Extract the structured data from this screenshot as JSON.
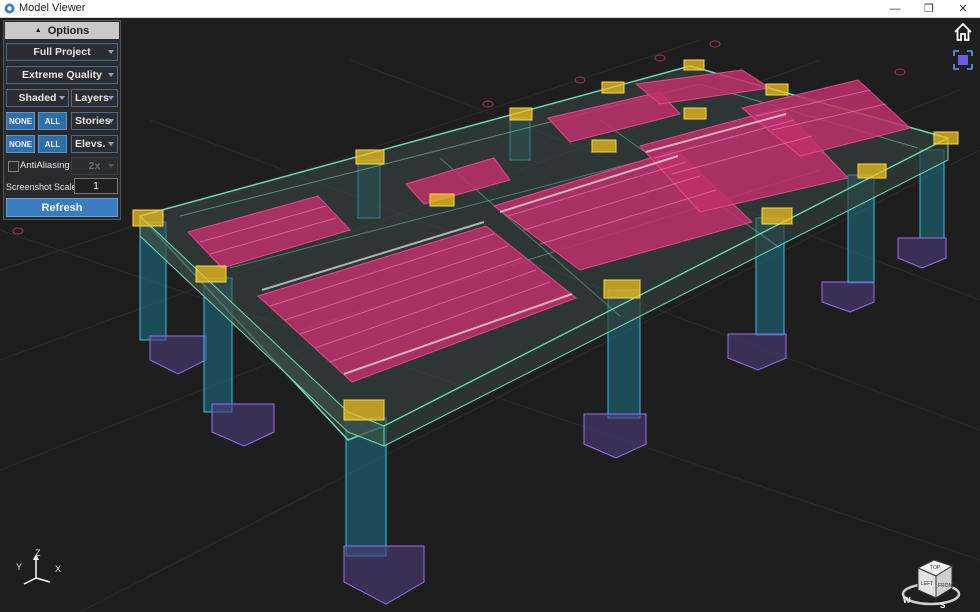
{
  "window": {
    "title": "Model Viewer",
    "controls": {
      "minimize": "—",
      "maximize": "❐",
      "close": "✕"
    }
  },
  "options_panel": {
    "header": "Options",
    "project_select": "Full Project",
    "quality_select": "Extreme Quality",
    "shading_select": "Shaded",
    "layers_select": "Layers",
    "stories_row": {
      "none": "NONE",
      "all": "ALL",
      "select": "Stories"
    },
    "elevs_row": {
      "none": "NONE",
      "all": "ALL",
      "select": "Elevs."
    },
    "antialiasing": {
      "label": "AntiAliasing",
      "checked": false,
      "value": "2x"
    },
    "screenshot_scale": {
      "label": "Screenshot Scale",
      "value": "1"
    },
    "refresh_label": "Refresh"
  },
  "axis_triad": {
    "z": "Z",
    "y": "Y",
    "x": "X"
  },
  "nav_cube": {
    "faces": [
      "TOP",
      "LEFT",
      "FRONT"
    ],
    "compass": [
      "W",
      "S"
    ]
  },
  "toolbar_icons": [
    "home-icon",
    "fit-view-icon"
  ],
  "colors": {
    "background": "#1e1e1f",
    "columns": "#2ec4e6",
    "footings": "#9b6cf0",
    "slab_edges": "#6fdcae",
    "column_caps": "#f0c020",
    "rebar_mesh": "#c0306a",
    "accent_button": "#3b7bc0"
  }
}
